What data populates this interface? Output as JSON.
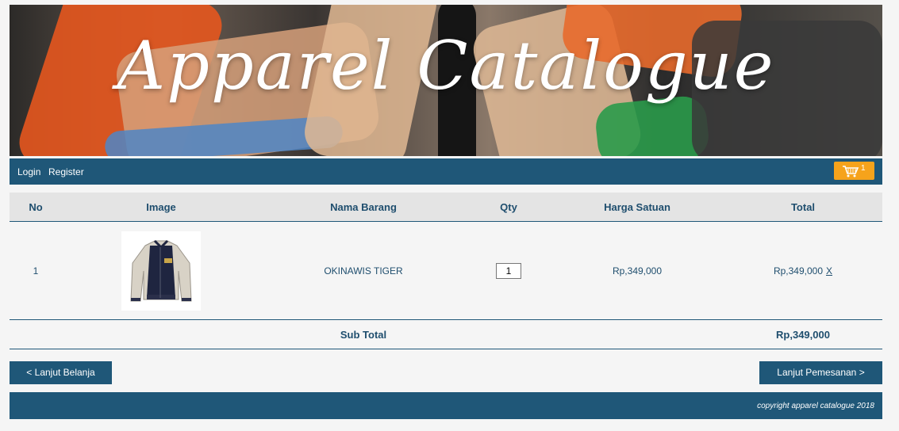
{
  "banner": {
    "title": "Apparel Catalogue"
  },
  "nav": {
    "login": "Login",
    "register": "Register",
    "cart_count": "1"
  },
  "table": {
    "headers": [
      "No",
      "Image",
      "Nama Barang",
      "Qty",
      "Harga Satuan",
      "Total"
    ],
    "rows": [
      {
        "no": "1",
        "name": "OKINAWIS TIGER",
        "qty": "1",
        "price": "Rp,349,000",
        "total": "Rp,349,000",
        "remove": "X"
      }
    ],
    "subtotal_label": "Sub Total",
    "subtotal_value": "Rp,349,000"
  },
  "buttons": {
    "back": "< Lanjut Belanja",
    "next": "Lanjut Pemesanan >"
  },
  "footer": {
    "copyright": "copyright apparel catalogue 2018"
  },
  "colors": {
    "primary": "#1f5778",
    "cart_accent": "#f6a31b",
    "header_bg": "#e4e4e4"
  },
  "icons": {
    "cart": "shopping-cart-icon",
    "product": "jacket-image"
  }
}
